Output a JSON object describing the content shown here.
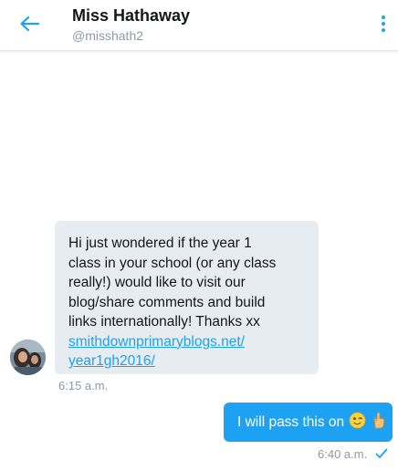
{
  "header": {
    "title": "Miss Hathaway",
    "handle": "@misshath2",
    "back_icon": "arrow-left-icon",
    "menu_icon": "more-vertical-icon"
  },
  "colors": {
    "accent": "#1da1f2",
    "incoming_bubble": "#e6ecf0",
    "timestamp": "#8c9aa6"
  },
  "messages": [
    {
      "direction": "incoming",
      "text": "Hi just wondered if the year 1\nclass in your school (or any class\nreally!) would like to visit our\nblog/share comments and build\nlinks internationally! Thanks xx",
      "link": "smithdownprimaryblogs.net/\nyear1gh2016/",
      "time": "6:15 a.m.",
      "avatar_icon": "avatar-photo"
    },
    {
      "direction": "outgoing",
      "text": "I will pass this on",
      "emojis": [
        "winking-face-emoji",
        "ok-hand-emoji"
      ],
      "time": "6:40 a.m.",
      "status_icon": "check-icon"
    }
  ]
}
